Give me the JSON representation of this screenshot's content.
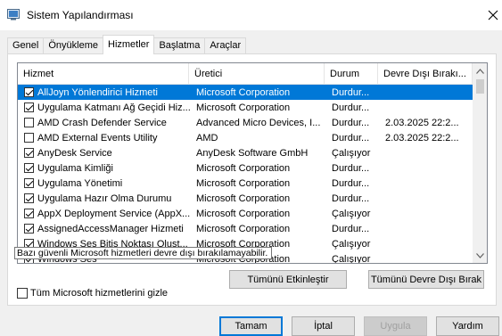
{
  "window": {
    "title": "Sistem Yapılandırması",
    "close_glyph": "✕"
  },
  "tabs": [
    {
      "label": "Genel",
      "active": false
    },
    {
      "label": "Önyükleme",
      "active": false
    },
    {
      "label": "Hizmetler",
      "active": true
    },
    {
      "label": "Başlatma",
      "active": false
    },
    {
      "label": "Araçlar",
      "active": false
    }
  ],
  "columns": {
    "name": "Hizmet",
    "maker": "Üretici",
    "status": "Durum",
    "disabled_date": "Devre Dışı Bırakı..."
  },
  "services": [
    {
      "checked": true,
      "name": "AllJoyn Yönlendirici Hizmeti",
      "maker": "Microsoft Corporation",
      "status": "Durdur...",
      "date": "",
      "selected": true
    },
    {
      "checked": true,
      "name": "Uygulama Katmanı Ağ Geçidi Hiz...",
      "maker": "Microsoft Corporation",
      "status": "Durdur...",
      "date": "",
      "selected": false
    },
    {
      "checked": false,
      "name": "AMD Crash Defender Service",
      "maker": "Advanced Micro Devices, I...",
      "status": "Durdur...",
      "date": "2.03.2025 22:2...",
      "selected": false
    },
    {
      "checked": false,
      "name": "AMD External Events Utility",
      "maker": "AMD",
      "status": "Durdur...",
      "date": "2.03.2025 22:2...",
      "selected": false
    },
    {
      "checked": true,
      "name": "AnyDesk Service",
      "maker": "AnyDesk Software GmbH",
      "status": "Çalışıyor",
      "date": "",
      "selected": false
    },
    {
      "checked": true,
      "name": "Uygulama Kimliği",
      "maker": "Microsoft Corporation",
      "status": "Durdur...",
      "date": "",
      "selected": false
    },
    {
      "checked": true,
      "name": "Uygulama Yönetimi",
      "maker": "Microsoft Corporation",
      "status": "Durdur...",
      "date": "",
      "selected": false
    },
    {
      "checked": true,
      "name": "Uygulama Hazır Olma Durumu",
      "maker": "Microsoft Corporation",
      "status": "Durdur...",
      "date": "",
      "selected": false
    },
    {
      "checked": true,
      "name": "AppX Deployment Service (AppX...",
      "maker": "Microsoft Corporation",
      "status": "Çalışıyor",
      "date": "",
      "selected": false
    },
    {
      "checked": true,
      "name": "AssignedAccessManager Hizmeti",
      "maker": "Microsoft Corporation",
      "status": "Durdur...",
      "date": "",
      "selected": false
    },
    {
      "checked": true,
      "name": "Windows Ses Bitiş Noktası Olust...",
      "maker": "Microsoft Corporation",
      "status": "Çalışıyor",
      "date": "",
      "selected": false
    },
    {
      "checked": true,
      "name": "Windows Ses",
      "maker": "Microsoft Corporation",
      "status": "Çalışıyor",
      "date": "",
      "selected": false
    }
  ],
  "tooltip": "Bazı güvenli Microsoft hizmetleri devre dışı bırakılamayabilir.",
  "buttons": {
    "enable_all": "Tümünü Etkinleştir",
    "disable_all": "Tümünü Devre Dışı Bırak",
    "ok": "Tamam",
    "cancel": "İptal",
    "apply": "Uygula",
    "help": "Yardım"
  },
  "hide_ms": {
    "label": "Tüm Microsoft hizmetlerini gizle",
    "checked": false
  },
  "colors": {
    "selection": "#0078d7",
    "accent": "#0078d7"
  }
}
